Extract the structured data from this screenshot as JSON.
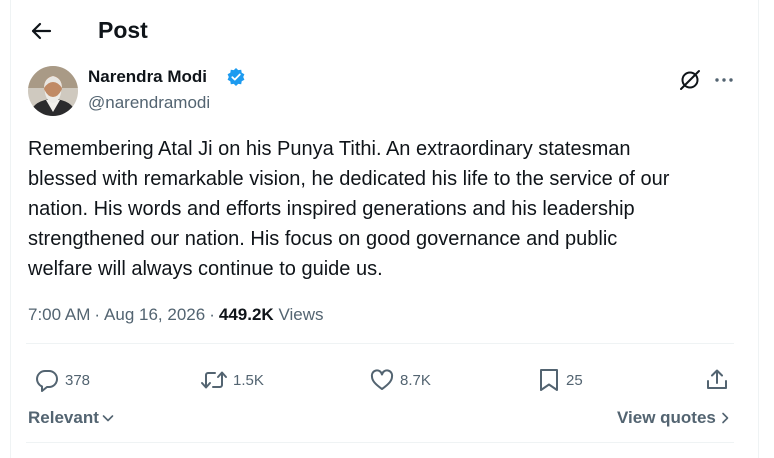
{
  "header": {
    "title": "Post"
  },
  "author": {
    "name": "Narendra Modi",
    "handle": "@narendramodi",
    "verified_color": "#1d9bf0"
  },
  "tweet": {
    "text": "Remembering Atal Ji on his Punya Tithi. An extraordinary statesman\nblessed with remarkable vision, he dedicated his life to the service of our\nnation. His words and efforts inspired generations and his leadership\nstrengthened our nation. His focus on good governance and public\nwelfare will always continue to guide us."
  },
  "meta": {
    "time": "7:00 AM",
    "date": "Aug 16, 2026",
    "views_count": "449.2K",
    "views_label": "Views"
  },
  "actions": {
    "replies": "378",
    "reposts": "1.5K",
    "likes": "8.7K",
    "bookmarks": "25"
  },
  "footer": {
    "sort_label": "Relevant",
    "view_quotes_label": "View quotes"
  },
  "colors": {
    "text": "#0f1419",
    "secondary": "#536471",
    "border": "#eff3f4"
  }
}
